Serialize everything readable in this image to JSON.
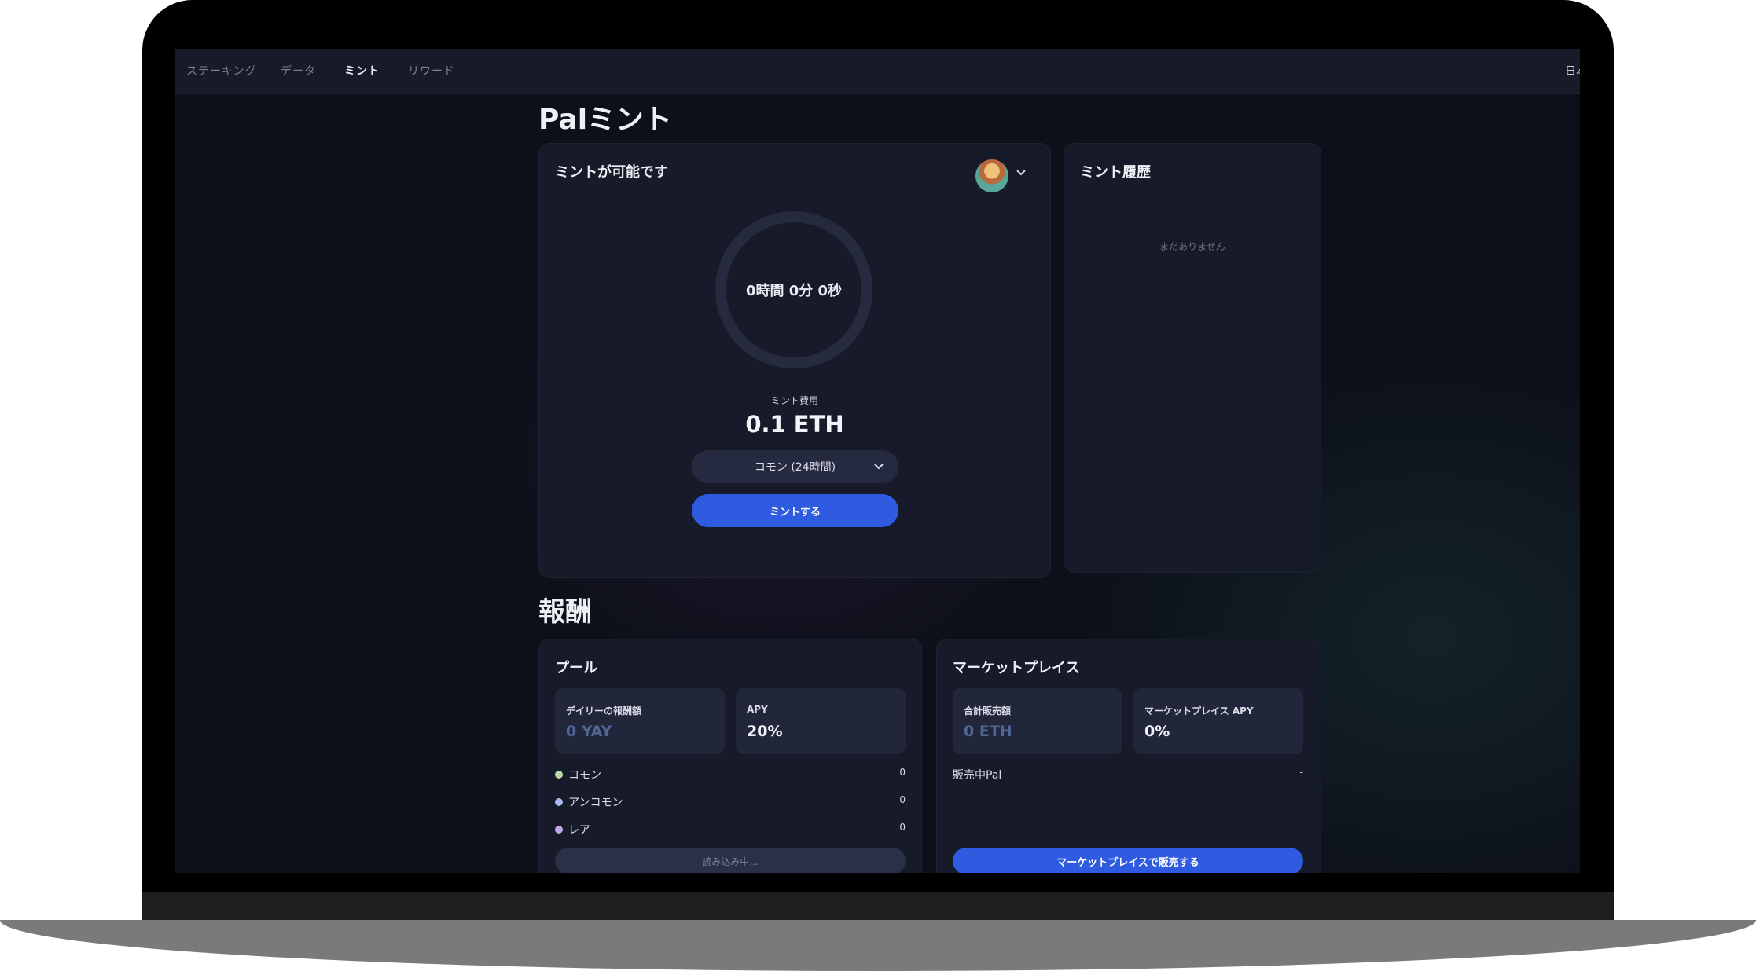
{
  "nav": {
    "items": [
      {
        "label": "ステーキング",
        "active": false
      },
      {
        "label": "データ",
        "active": false
      },
      {
        "label": "ミント",
        "active": true
      },
      {
        "label": "リワード",
        "active": false
      }
    ],
    "language": "日本"
  },
  "mint_section": {
    "heading": "Palミント",
    "mint_card": {
      "title": "ミントが可能です",
      "timer": "0時間 0分 0秒",
      "cost_label": "ミント費用",
      "cost_value": "0.1 ETH",
      "rarity_select": "コモン (24時間)",
      "mint_button": "ミントする"
    },
    "history_card": {
      "title": "ミント履歴",
      "empty_text": "まだありません"
    }
  },
  "rewards_section": {
    "heading": "報酬",
    "pool_card": {
      "title": "プール",
      "daily_reward": {
        "label": "デイリーの報酬額",
        "value": "0 YAY"
      },
      "apy": {
        "label": "APY",
        "value": "20%"
      },
      "rarities": [
        {
          "label": "コモン",
          "value": "0",
          "color": "#b9d9a8"
        },
        {
          "label": "アンコモン",
          "value": "0",
          "color": "#a9b8f0"
        },
        {
          "label": "レア",
          "value": "0",
          "color": "#c3a8e8"
        }
      ],
      "loading_button": "読み込み中..."
    },
    "market_card": {
      "title": "マーケットプレイス",
      "total_sales": {
        "label": "合計販売額",
        "value": "0 ETH"
      },
      "market_apy": {
        "label": "マーケットプレイス APY",
        "value": "0%"
      },
      "on_sale": {
        "label": "販売中Pal",
        "value": "-"
      },
      "sell_button": "マーケットプレイスで販売する"
    }
  },
  "colors": {
    "accent": "#2f5be0",
    "background": "#0d1019",
    "card": "#171a29"
  }
}
